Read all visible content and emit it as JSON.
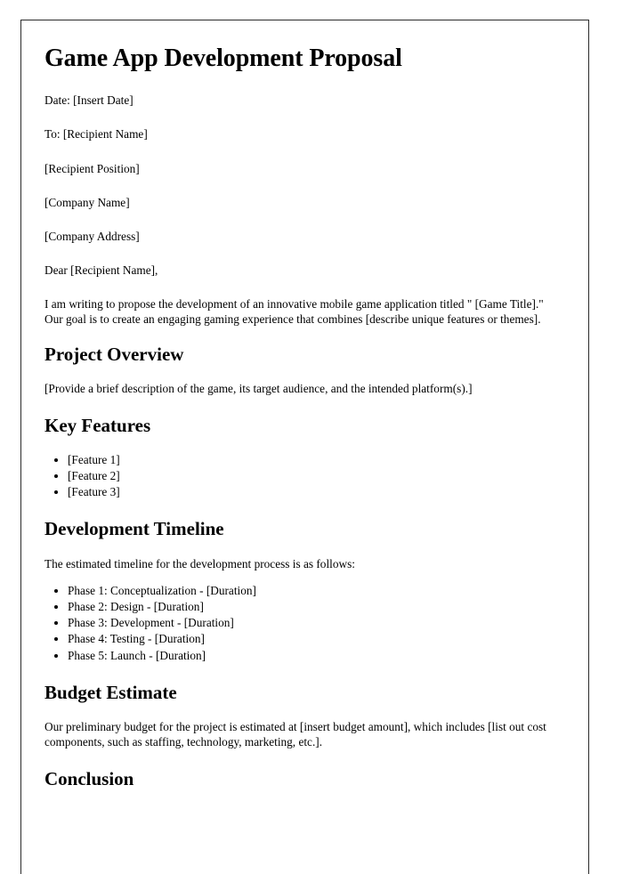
{
  "document": {
    "title": "Game App Development Proposal",
    "meta_lines": [
      "Date: [Insert Date]",
      "To: [Recipient Name]",
      "[Recipient Position]",
      "[Company Name]",
      "[Company Address]"
    ],
    "salutation": "Dear [Recipient Name],",
    "intro_paragraph": "I am writing to propose the development of an innovative mobile game application titled \" [Game Title].\" Our goal is to create an engaging gaming experience that combines [describe unique features or themes].",
    "sections": {
      "project_overview": {
        "heading": "Project Overview",
        "body": "[Provide a brief description of the game, its target audience, and the intended platform(s).]"
      },
      "key_features": {
        "heading": "Key Features",
        "items": [
          "[Feature 1]",
          "[Feature 2]",
          "[Feature 3]"
        ]
      },
      "development_timeline": {
        "heading": "Development Timeline",
        "lead_in": "The estimated timeline for the development process is as follows:",
        "items": [
          "Phase 1: Conceptualization - [Duration]",
          "Phase 2: Design - [Duration]",
          "Phase 3: Development - [Duration]",
          "Phase 4: Testing - [Duration]",
          "Phase 5: Launch - [Duration]"
        ]
      },
      "budget_estimate": {
        "heading": "Budget Estimate",
        "body": "Our preliminary budget for the project is estimated at [insert budget amount], which includes [list out cost components, such as staffing, technology, marketing, etc.]."
      },
      "conclusion": {
        "heading": "Conclusion"
      }
    }
  }
}
